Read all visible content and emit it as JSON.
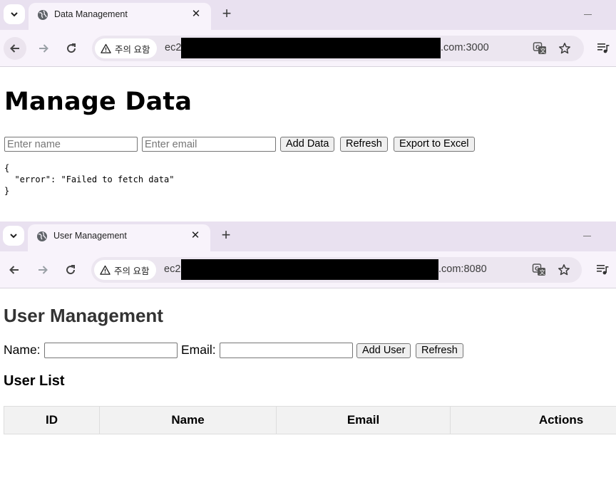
{
  "window1": {
    "tab_title": "Data Management",
    "omnibox": {
      "security_label": "주의 요함",
      "url_prefix": "ec2",
      "url_suffix": ".com:3000"
    },
    "page": {
      "heading": "Manage Data",
      "name_placeholder": "Enter name",
      "email_placeholder": "Enter email",
      "add_label": "Add Data",
      "refresh_label": "Refresh",
      "export_label": "Export to Excel",
      "output": "{\n  \"error\": \"Failed to fetch data\"\n}"
    }
  },
  "window2": {
    "tab_title": "User Management",
    "omnibox": {
      "security_label": "주의 요함",
      "url_prefix": "ec2",
      "url_suffix": ".com:8080"
    },
    "page": {
      "heading": "User Management",
      "name_label": "Name:",
      "email_label": "Email:",
      "add_label": "Add User",
      "refresh_label": "Refresh",
      "list_heading": "User List",
      "columns": [
        "ID",
        "Name",
        "Email",
        "Actions"
      ]
    }
  },
  "colors": {
    "tabstrip": "#e9e1f0",
    "active_tab": "#f8f3fb",
    "omnibox": "#ece6f0",
    "heading2": "#333333",
    "table_header": "#f2f2f2"
  },
  "icons": [
    "chevron-down-icon",
    "globe-icon",
    "close-icon",
    "plus-icon",
    "minimize-icon",
    "back-arrow-icon",
    "forward-arrow-icon",
    "reload-icon",
    "warning-icon",
    "translate-icon",
    "star-icon",
    "media-queue-icon"
  ]
}
